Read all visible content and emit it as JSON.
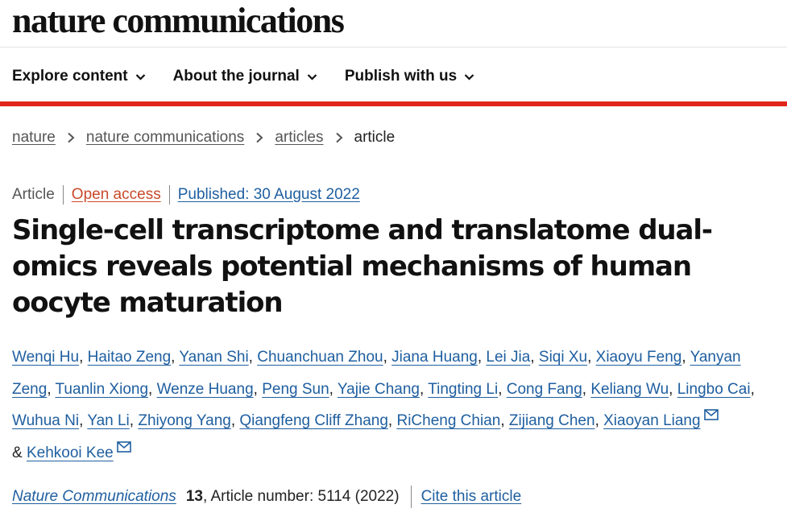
{
  "header": {
    "logo": "nature communications"
  },
  "nav": [
    {
      "label": "Explore content"
    },
    {
      "label": "About the journal"
    },
    {
      "label": "Publish with us"
    }
  ],
  "breadcrumb": [
    {
      "label": "nature"
    },
    {
      "label": "nature communications"
    },
    {
      "label": "articles"
    },
    {
      "label": "article"
    }
  ],
  "article": {
    "type": "Article",
    "access": "Open access",
    "published": "Published: 30 August 2022",
    "title": "Single-cell transcriptome and translatome dual-omics reveals potential mechanisms of human oocyte maturation",
    "authors": [
      "Wenqi Hu",
      "Haitao Zeng",
      "Yanan Shi",
      "Chuanchuan Zhou",
      "Jiana Huang",
      "Lei Jia",
      "Siqi Xu",
      "Xiaoyu Feng",
      "Yanyan Zeng",
      "Tuanlin Xiong",
      "Wenze Huang",
      "Peng Sun",
      "Yajie Chang",
      "Tingting Li",
      "Cong Fang",
      "Keliang Wu",
      "Lingbo Cai",
      "Wuhua Ni",
      "Yan Li",
      "Zhiyong Yang",
      "Qiangfeng Cliff Zhang",
      "RiCheng Chian",
      "Zijiang Chen",
      "Xiaoyan Liang",
      "Kehkooi Kee"
    ],
    "corresponding_icon": "mail-icon",
    "ampersand": "&",
    "journal": "Nature Communications",
    "volume": "13",
    "article_number": ", Article number: 5114 (2022)",
    "cite_label": "Cite this article"
  },
  "colors": {
    "accent_red": "#e1251b",
    "link_blue": "#1f5fa0",
    "open_access": "#c84a2a"
  }
}
